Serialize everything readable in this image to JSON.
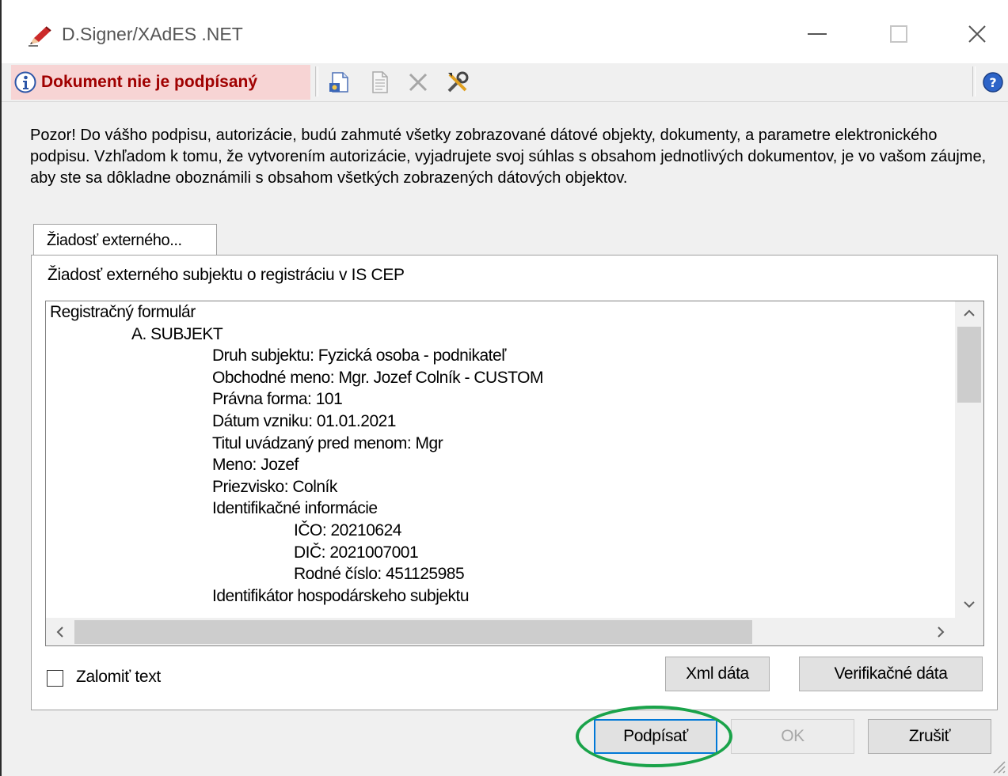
{
  "window": {
    "title": "D.Signer/XAdES .NET"
  },
  "toolbar": {
    "status_text": "Dokument nie je podpísaný"
  },
  "warning": {
    "text": "Pozor! Do vášho podpisu, autorizácie, budú zahmuté všetky zobrazované dátové objekty, dokumenty, a parametre elektronického podpisu. Vzhľadom k tomu, že vytvorením autorizácie, vyjadrujete svoj súhlas s obsahom jednotlivých dokumentov, je vo vašom záujme, aby ste sa dôkladne oboznámili s obsahom všetkých zobrazených dátových objektov."
  },
  "tab": {
    "label": "Žiadosť externého..."
  },
  "document": {
    "title": "Žiadosť externého subjektu o registráciu v IS CEP",
    "lines": [
      {
        "indent": 0,
        "text": "Registračný formulár"
      },
      {
        "indent": 1,
        "text": "A. SUBJEKT"
      },
      {
        "indent": 2,
        "text": "Druh subjektu: Fyzická osoba - podnikateľ"
      },
      {
        "indent": 2,
        "text": "Obchodné meno: Mgr. Jozef Colník - CUSTOM"
      },
      {
        "indent": 2,
        "text": "Právna forma: 101"
      },
      {
        "indent": 2,
        "text": "Dátum vzniku: 01.01.2021"
      },
      {
        "indent": 2,
        "text": "Titul uvádzaný pred menom: Mgr"
      },
      {
        "indent": 2,
        "text": "Meno: Jozef"
      },
      {
        "indent": 2,
        "text": "Priezvisko: Colník"
      },
      {
        "indent": 2,
        "text": "Identifikačné informácie"
      },
      {
        "indent": 3,
        "text": "IČO: 20210624"
      },
      {
        "indent": 3,
        "text": "DIČ: 2021007001"
      },
      {
        "indent": 3,
        "text": "Rodné číslo: 451125985"
      },
      {
        "indent": 2,
        "text": "Identifikátor hospodárskeho subjektu"
      }
    ]
  },
  "options": {
    "wrap_label": "Zalomiť text",
    "wrap_checked": false
  },
  "buttons": {
    "xml": "Xml dáta",
    "verify": "Verifikačné dáta",
    "sign": "Podpísať",
    "ok": "OK",
    "cancel": "Zrušiť"
  },
  "colors": {
    "status_background": "#f7d4d4",
    "status_text": "#a00000",
    "highlight": "#1aa34a",
    "dialog_background": "#f0f0f0"
  },
  "icons": [
    "pen-icon",
    "minimize-icon",
    "maximize-icon",
    "close-icon",
    "info-icon",
    "sign-document-icon",
    "document-icon",
    "delete-icon",
    "settings-icon",
    "help-icon"
  ]
}
